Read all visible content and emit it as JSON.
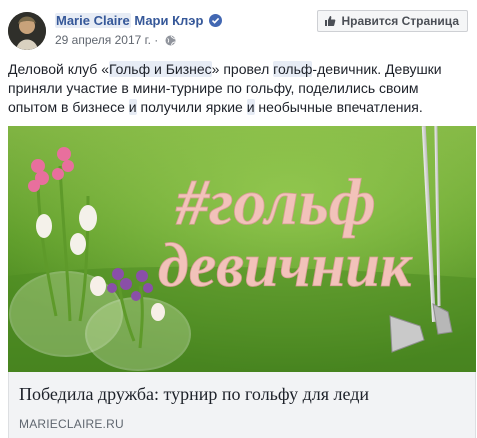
{
  "post": {
    "page_name_en": "Marie Claire",
    "page_name_ru": "Мари Клэр",
    "date": "29 апреля 2017 г.",
    "separator": "·",
    "like_button_label": "Нравится Страница",
    "text_parts": [
      "Деловой клуб «",
      "Гольф и Бизнес",
      "» провел ",
      "гольф",
      "-девичник. Девушки приняли участие в мини-турнире по гольфу, поделились своим опытом в бизнесе ",
      "и",
      " получили яркие ",
      "и",
      " необычные впечатления."
    ]
  },
  "image": {
    "sign_line1": "#гольф",
    "sign_line2": "девичник"
  },
  "link": {
    "title": "Победила дружба: турнир по гольфу для леди",
    "domain": "MARIECLAIRE.RU"
  },
  "colors": {
    "link_blue": "#365899",
    "verified_blue": "#4267b2",
    "grass_green": "#5a9a2a",
    "sign_pink": "#f2c2ba"
  },
  "icons": [
    "verified-badge-icon",
    "globe-icon",
    "thumbs-up-icon"
  ]
}
